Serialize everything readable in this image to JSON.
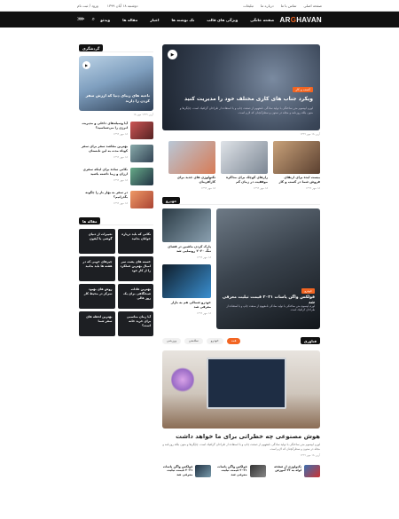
{
  "topbar": {
    "links": [
      "صفحه اصلی",
      "تماس با ما",
      "درباره ما",
      "تبلیغات"
    ],
    "date": "دوشنبه ۱۸ آبان ۱۳۹۹",
    "login": "ورود / ثبت نام"
  },
  "navbar": {
    "logo_prefix": "AR",
    "logo_accent": "G",
    "logo_rest": "HAVAN",
    "menu": [
      "صفحه خانگی",
      "ویژگی های قالب",
      "تک نوشته ها",
      "اخبار",
      "مقاله ها",
      "ویدئو"
    ]
  },
  "sidebar": {
    "section1_title": "گردشگری",
    "hero_title": "ناحیه های زیبای دنیا که ارزش سفر کردن را دارند",
    "hero_meta": "آرین ۱۳۹۹ مهر ۱۸",
    "list": [
      {
        "title": "آیا وسیله‌های داخلی و مدیریت انرژی را می‌شناسید؟",
        "meta": "۱۸ مهر ۱۳۹۹"
      },
      {
        "title": "بهترین مقاصد سفر برای سفر کوتاه مدت به این تابستان",
        "meta": "۱۸ مهر ۱۳۹۹"
      },
      {
        "title": "نکاتی ساده برای اینکه سفری ارزان و زیبا داشته باشید",
        "meta": "۱۸ مهر ۱۳۹۹"
      },
      {
        "title": "در سفر به بهار باز را چگونه بگذرانیم؟",
        "meta": "۱۸ مهر ۱۳۹۹"
      }
    ],
    "section2_title": "مقاله ها",
    "grid": [
      "نکاتی که باید درباره جوانان بدانید",
      "تغییرات از دنیای گوشی یا آیفون",
      "خسته های پشت سر امیال بهترین عملکرد را از کار خود",
      "چیزهای خوبی که در هفته ها باید بدانید",
      "بهترین عادات صبحگاهی برای یک روز عالی",
      "روش های بهبود تمرکز در محیط کار",
      "آیا زمان مناسبی برای خرید خانه است؟",
      "بهترین لحظه های سفر شما"
    ]
  },
  "hero": {
    "tag": "کسب و کار",
    "title": "ویکرد جناب های کاری مختلف خود را مدیریت کنید",
    "desc": "لورم ایپسوم متن ساختگی با تولید سادگی نامفهوم از صنعت چاپ و با استفاده از طراحان گرافیک است. چاپگرها و متون بلکه روزنامه و مجله در ستون و سطرآنچنان که لازم است.",
    "meta": "آرین ۱۸ مهر ۱۳۹۹"
  },
  "row3": [
    {
      "title": "بیست ایده برای ارتقای فروش شما در کسب و کار",
      "meta": "۱۸ مهر ۱۳۹۹"
    },
    {
      "title": "رازهای کوچک برای مذاکره موفقیت در زمان کم",
      "meta": "۱۸ مهر ۱۳۹۹"
    },
    {
      "title": "تکنولوژی های جدید برای کارآفرینان",
      "meta": "۱۸ مهر ۱۳۹۹"
    }
  ],
  "cars": {
    "section_title": "خودرو",
    "big_tag": "خودرو",
    "big_title": "فولکس واگن پاسات ۲۰۲۱ قیمت تیلیت معرفی شد",
    "big_desc": "لورم ایپسوم متن ساختگی با تولید سادگی نامفهوم از صنعت چاپ و با استفاده از طراحان گرافیک است.",
    "big_meta": "آرین ۱۸ مهر ۱۳۹۹",
    "smalls": [
      {
        "title": "پارک کردن ماشین در فضای تنگ ۲۰۲۰ رونمایی شد",
        "meta": "۱۸ مهر ۱۳۹۹"
      },
      {
        "title": "خودرو شمالی هم به بازار معرفی شد",
        "meta": "۱۸ مهر ۱۳۹۹"
      }
    ]
  },
  "tabs": {
    "label": "فناوری",
    "items": [
      "همه",
      "خودرو",
      "سلامتی",
      "ورزشی"
    ]
  },
  "feature": {
    "title": "هوش مصنوعی چه خطراتی برای ما خواهد داشت",
    "desc": "لورم ایپسوم متن ساختگی با تولید سادگی نامفهوم از صنعت چاپ و با استفاده از طراحان گرافیک است. چاپگرها و متون بلکه روزنامه و مجله در ستون و سطرآنچنان که لازم است.",
    "meta": "آرین ۱۸ مهر ۱۳۹۹"
  },
  "bottom": [
    {
      "title": "تکنولوژی از صفحه لوله به ۲۲ آموزش"
    },
    {
      "title": "فولکس واگن پاسات ۲۰۲۱ قیمت تیلیت معرفی شد"
    },
    {
      "title": "فولکس واگن پاسات ۲۰۲۱ قیمت تیلیت معرفی شد"
    }
  ]
}
